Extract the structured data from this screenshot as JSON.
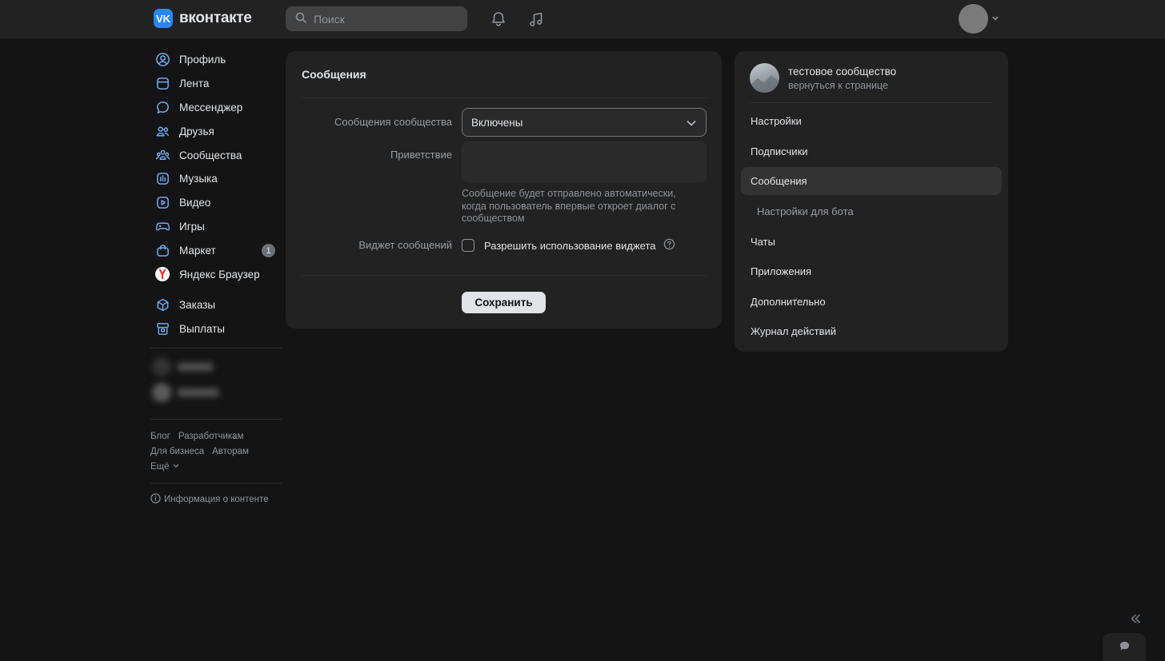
{
  "header": {
    "logo_text": "вконтакте",
    "logo_mark": "VK",
    "search_placeholder": "Поиск"
  },
  "leftnav": {
    "items": [
      {
        "label": "Профиль",
        "icon": "user-circle-icon"
      },
      {
        "label": "Лента",
        "icon": "feed-icon"
      },
      {
        "label": "Мессенджер",
        "icon": "message-icon"
      },
      {
        "label": "Друзья",
        "icon": "friends-icon"
      },
      {
        "label": "Сообщества",
        "icon": "communities-icon"
      },
      {
        "label": "Музыка",
        "icon": "music-icon"
      },
      {
        "label": "Видео",
        "icon": "video-icon"
      },
      {
        "label": "Игры",
        "icon": "gamepad-icon"
      },
      {
        "label": "Маркет",
        "icon": "market-bag-icon",
        "badge": "1"
      },
      {
        "label": "Яндекс Браузер",
        "icon": "yandex-browser-icon"
      }
    ],
    "items2": [
      {
        "label": "Заказы",
        "icon": "box-icon"
      },
      {
        "label": "Выплаты",
        "icon": "payout-icon"
      }
    ],
    "footer_links": [
      "Блог",
      "Разработчикам",
      "Для бизнеса",
      "Авторам",
      "Ещё"
    ],
    "info_text": "Информация о контенте"
  },
  "main": {
    "title": "Сообщения",
    "messages_label": "Сообщения сообщества",
    "messages_value": "Включены",
    "greeting_label": "Приветствие",
    "greeting_hint": "Сообщение будет отправлено автоматически, когда пользователь впервые откроет диалог с сообществом",
    "widget_label": "Виджет сообщений",
    "widget_checkbox": "Разрешить использование виджета",
    "save_label": "Сохранить"
  },
  "rightpanel": {
    "community_name": "тестовое сообщество",
    "community_sub": "вернуться к странице",
    "items": [
      {
        "label": "Настройки",
        "active": false,
        "sub": false
      },
      {
        "label": "Подписчики",
        "active": false,
        "sub": false
      },
      {
        "label": "Сообщения",
        "active": true,
        "sub": false
      },
      {
        "label": "Настройки для бота",
        "active": false,
        "sub": true
      },
      {
        "label": "Чаты",
        "active": false,
        "sub": false
      },
      {
        "label": "Приложения",
        "active": false,
        "sub": false
      },
      {
        "label": "Дополнительно",
        "active": false,
        "sub": false
      },
      {
        "label": "Журнал действий",
        "active": false,
        "sub": false
      }
    ]
  },
  "colors": {
    "background": "#141414",
    "surface": "#222222",
    "accent": "#2787f5",
    "text": "#e1e3e6",
    "secondary_text": "#8f9399"
  }
}
